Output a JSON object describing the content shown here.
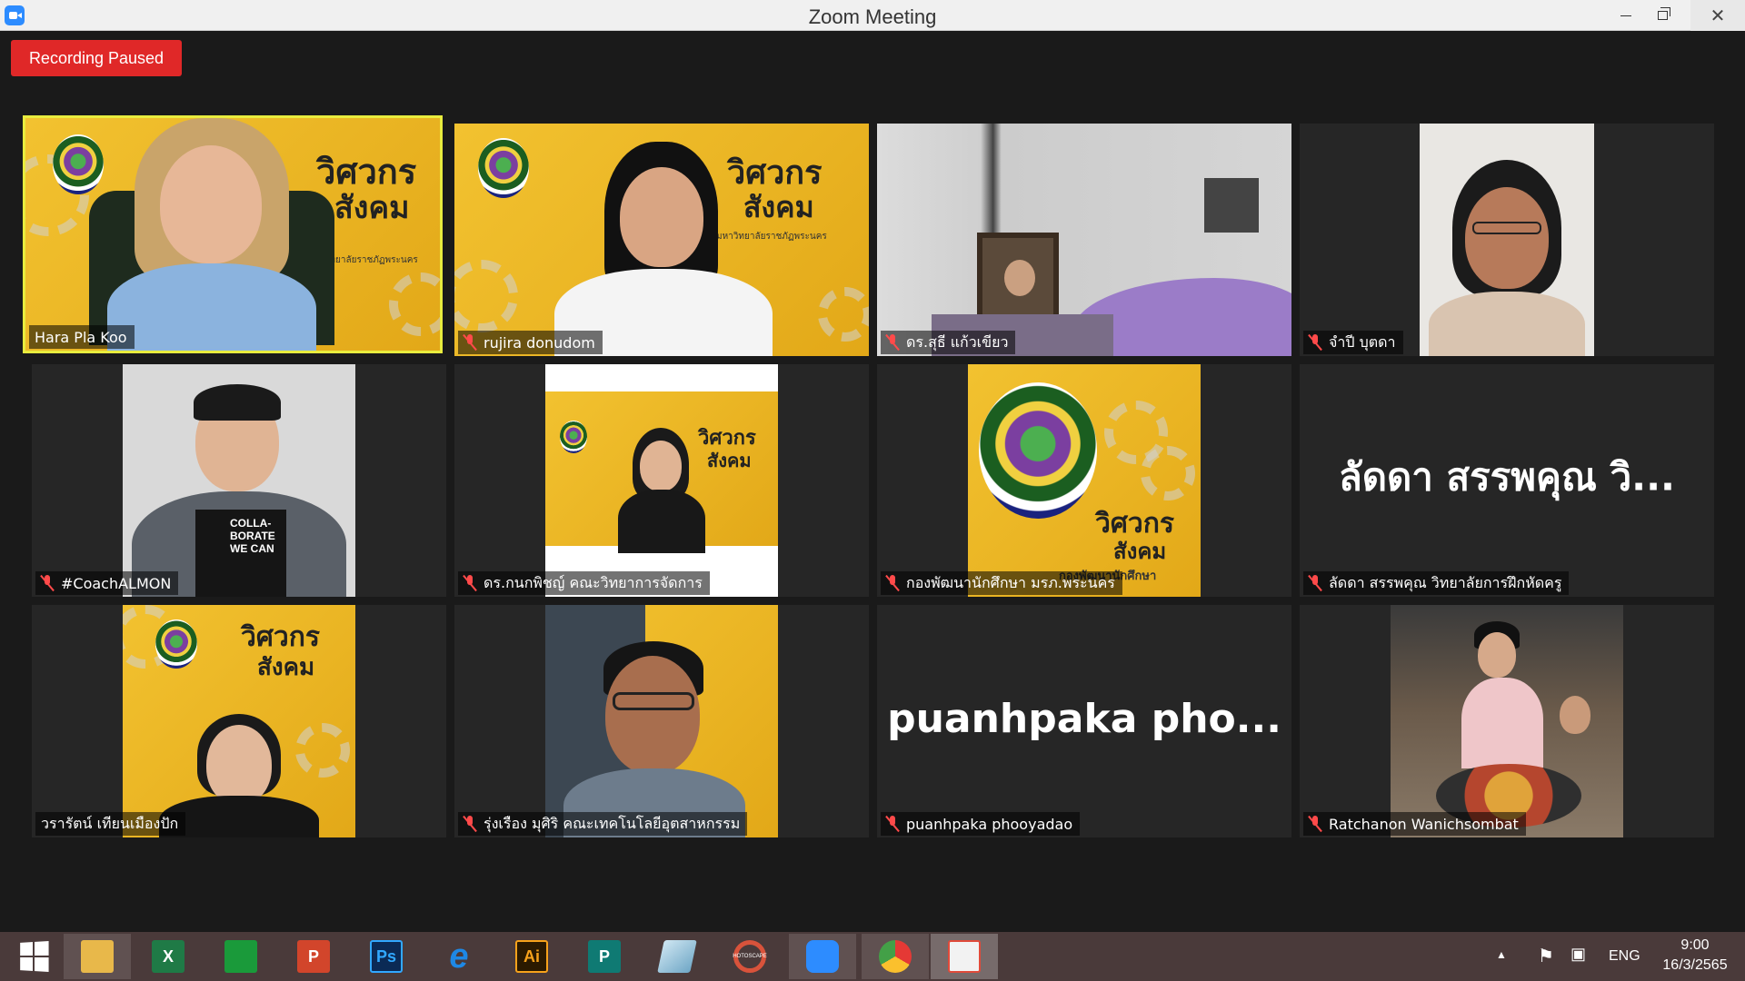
{
  "window": {
    "title": "Zoom Meeting",
    "close_glyph": "✕"
  },
  "meeting": {
    "recording_status": "Recording Paused",
    "active_speaker": "Hara Pla Koo",
    "banner": {
      "line1": "วิศวกร",
      "line2": "สังคม",
      "org": "มหาวิทยาลัยราชภัฏพระนคร",
      "org_sign": "กองพัฒนานักศึกษา",
      "seal_text": "PHRANAKHON RAJABHAT UNIVERSITY"
    },
    "participants": [
      {
        "name": "Hara Pla Koo",
        "muted": false
      },
      {
        "name": "rujira donudom",
        "muted": true
      },
      {
        "name": "ดร.สุธี  แก้วเขียว",
        "muted": true
      },
      {
        "name": "จำปี บุตดา",
        "muted": true
      },
      {
        "name": "#CoachALMON",
        "muted": true
      },
      {
        "name": "ดร.กนกพิชญ์ คณะวิทยาการจัดการ",
        "muted": true
      },
      {
        "name": "กองพัฒนานักศึกษา มรภ.พระนคร",
        "muted": true
      },
      {
        "name": "ลัดดา สรรพคุณ วิทยาลัยการฝึกหัดครู",
        "muted": true
      },
      {
        "name": "วรารัตน์ เทียนเมืองปัก",
        "muted": false
      },
      {
        "name": "รุ่งเรือง มุศิริ คณะเทคโนโลยีอุตสาหกรรม",
        "muted": true
      },
      {
        "name": "puanhpaka phooyadao",
        "muted": true
      },
      {
        "name": "Ratchanon Wanichsombat",
        "muted": true
      }
    ],
    "placeholders": {
      "laddar": "ลัดดา สรรพคุณ วิ...",
      "puanhpaka": "puanhpaka  pho..."
    },
    "shirt_text": "COLLA- BORATE WE CAN"
  },
  "taskbar": {
    "apps": [
      {
        "name": "File Explorer",
        "icon": "folder-icon",
        "color": "#e8b84a"
      },
      {
        "name": "Excel",
        "icon": "excel-icon",
        "color": "#1f7a46",
        "glyph": "X"
      },
      {
        "name": "Store",
        "icon": "store-icon",
        "color": "#1a9a3a"
      },
      {
        "name": "PowerPoint",
        "icon": "powerpoint-icon",
        "color": "#d2452b",
        "glyph": "P"
      },
      {
        "name": "Photoshop",
        "icon": "photoshop-icon",
        "color": "#0b2a55",
        "glyph": "Ps"
      },
      {
        "name": "Internet Explorer",
        "icon": "ie-icon",
        "color": "#1e88e5",
        "glyph": "e"
      },
      {
        "name": "Illustrator",
        "icon": "illustrator-icon",
        "color": "#f7a21b",
        "glyph": "Ai"
      },
      {
        "name": "Publisher",
        "icon": "publisher-icon",
        "color": "#0f7a73",
        "glyph": "P"
      },
      {
        "name": "Notepad",
        "icon": "notepad-icon",
        "color": "#6fa7c6"
      },
      {
        "name": "PhotoScape",
        "icon": "photoscape-icon",
        "color": "#8a5a4a",
        "glyph": "HOTOSCAPE"
      },
      {
        "name": "Zoom",
        "icon": "zoom-icon",
        "color": "#2d8cff"
      },
      {
        "name": "Chrome",
        "icon": "chrome-icon",
        "color": "#e53935"
      },
      {
        "name": "Paint",
        "icon": "paint-icon",
        "color": "#f2f2f2"
      }
    ],
    "language": "ENG",
    "time": "9:00",
    "date": "16/3/2565"
  }
}
